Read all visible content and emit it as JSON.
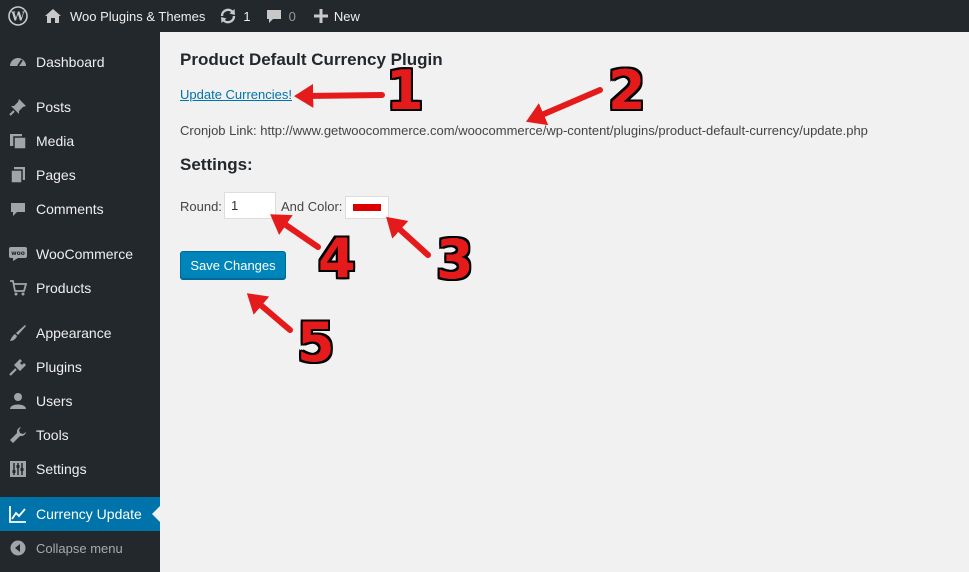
{
  "admin_bar": {
    "site_name": "Woo Plugins & Themes",
    "updates_count": "1",
    "comments_count": "0",
    "new_label": "New"
  },
  "sidebar": {
    "items": [
      {
        "label": "Dashboard",
        "icon": "dashboard-icon"
      },
      {
        "label": "Posts",
        "icon": "pin-icon"
      },
      {
        "label": "Media",
        "icon": "media-icon"
      },
      {
        "label": "Pages",
        "icon": "pages-icon"
      },
      {
        "label": "Comments",
        "icon": "comment-icon"
      },
      {
        "label": "WooCommerce",
        "icon": "woo-icon"
      },
      {
        "label": "Products",
        "icon": "cart-icon"
      },
      {
        "label": "Appearance",
        "icon": "brush-icon"
      },
      {
        "label": "Plugins",
        "icon": "plug-icon"
      },
      {
        "label": "Users",
        "icon": "user-icon"
      },
      {
        "label": "Tools",
        "icon": "wrench-icon"
      },
      {
        "label": "Settings",
        "icon": "sliders-icon"
      },
      {
        "label": "Currency Update",
        "icon": "chart-icon",
        "current": true
      }
    ],
    "collapse_label": "Collapse menu"
  },
  "main": {
    "title": "Product Default Currency Plugin",
    "update_link": "Update Currencies!",
    "cronjob_label": "Cronjob Link:",
    "cronjob_url": "http://www.getwoocommerce.com/woocommerce/wp-content/plugins/product-default-currency/update.php",
    "settings_title": "Settings:",
    "round_label": "Round:",
    "round_value": "1",
    "color_label": "And Color:",
    "color_value": "#dd0000",
    "save_label": "Save Changes"
  },
  "annotations": [
    "1",
    "2",
    "3",
    "4",
    "5"
  ],
  "colors": {
    "annotation": "#e51b1b",
    "admin_dark": "#23282d",
    "accent": "#0073aa",
    "button": "#0085ba"
  }
}
